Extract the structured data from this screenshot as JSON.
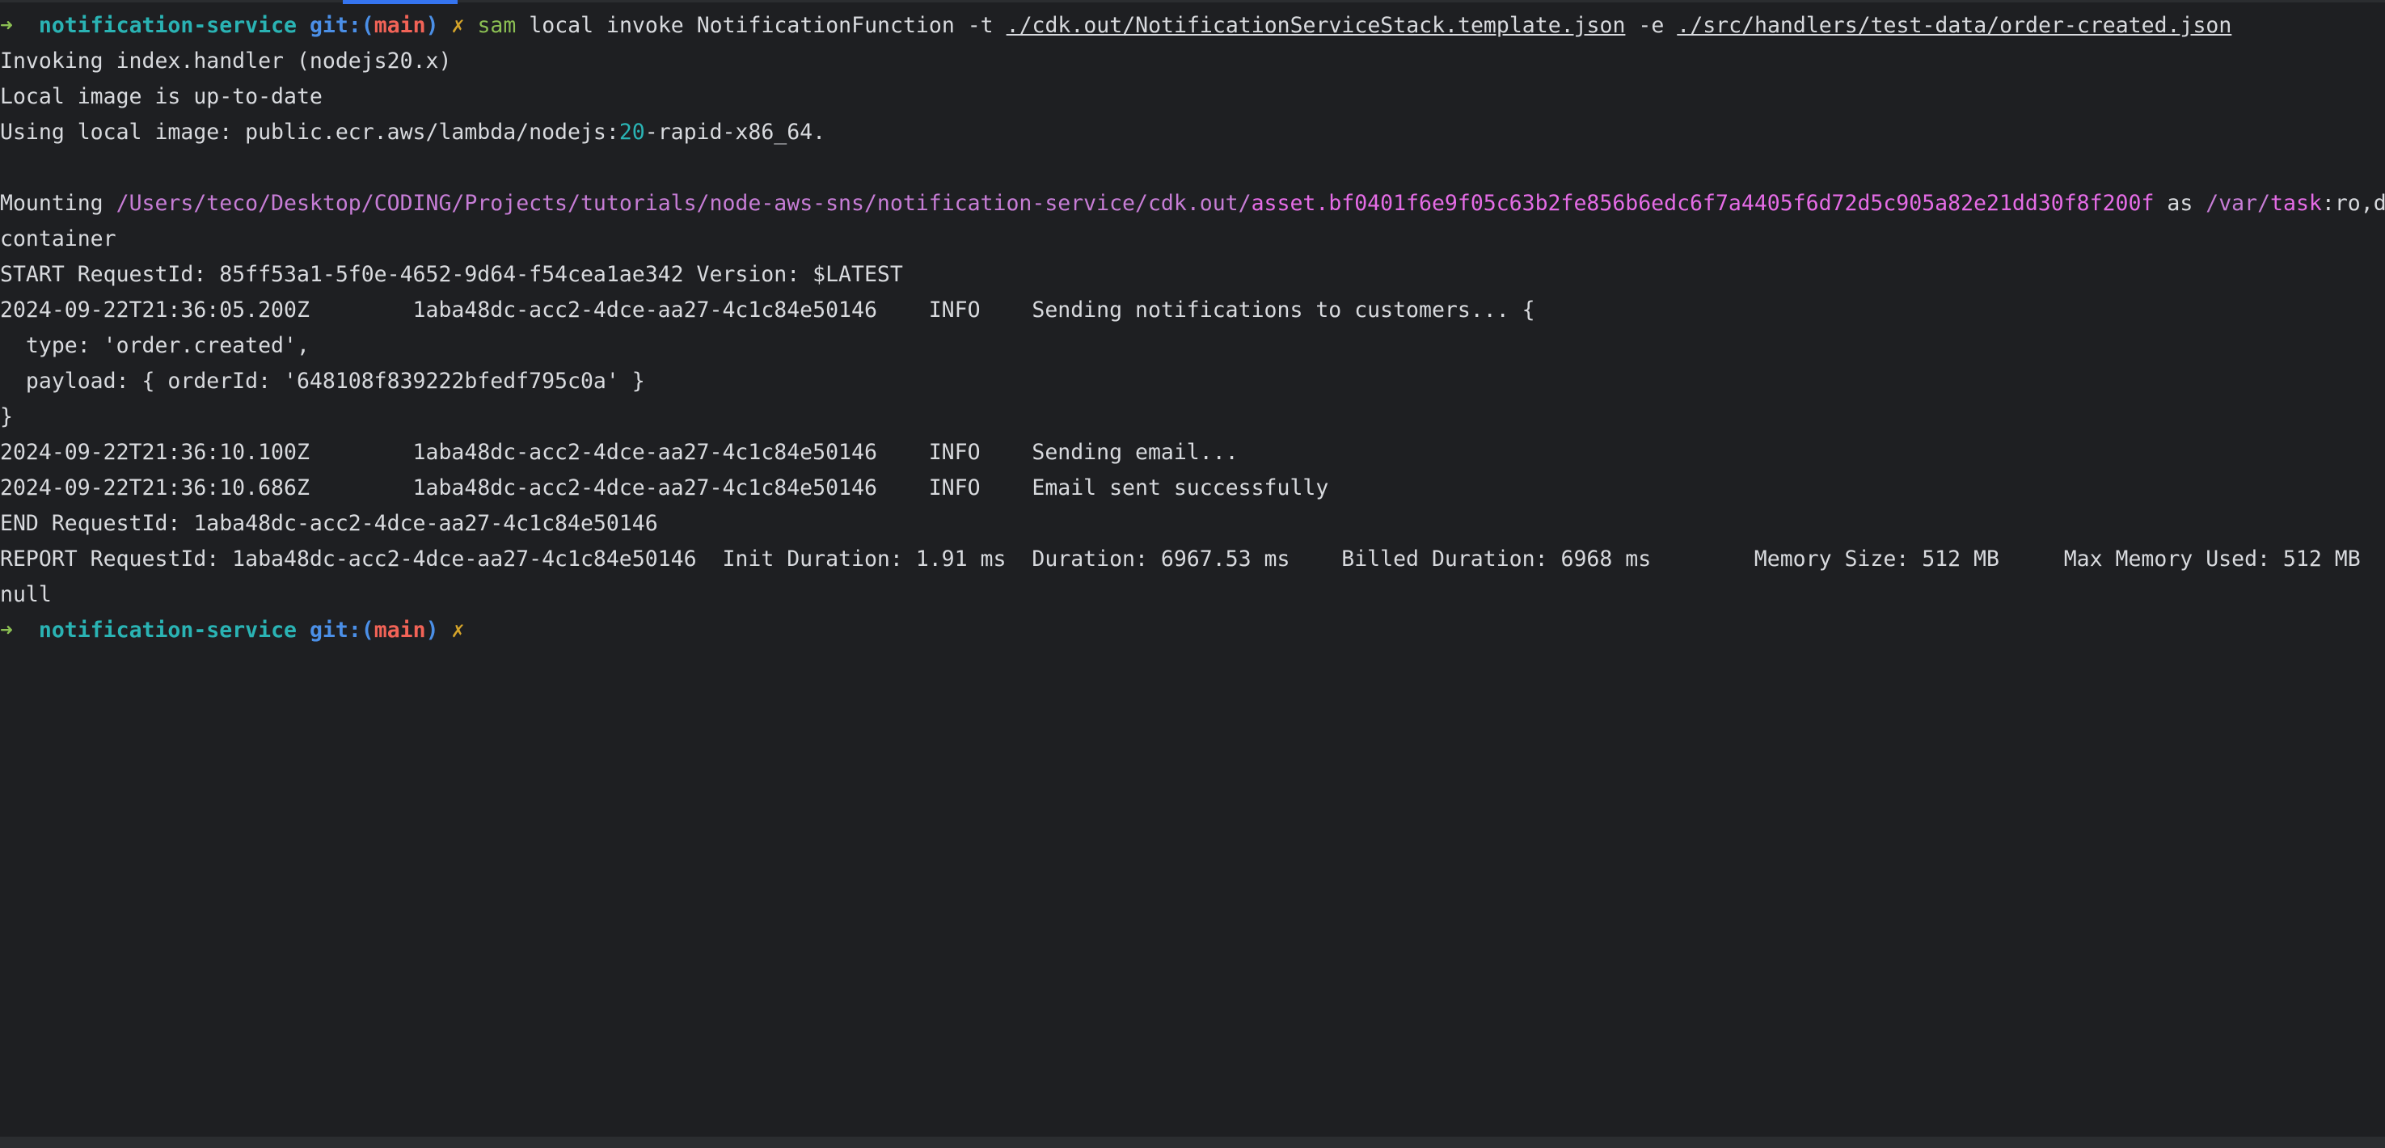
{
  "prompt": {
    "arrow": "➜",
    "directory": "notification-service",
    "git_prefix": "git:(",
    "branch": "main",
    "git_suffix": ")",
    "dirty_marker": "✗"
  },
  "command": {
    "program": "sam",
    "args_part1": "local invoke NotificationFunction -t",
    "template_path": "./cdk.out/NotificationServiceStack.template.json",
    "flag_e": "-e",
    "event_path": "./src/handlers/test-data/order-created.json"
  },
  "output": {
    "invoking": "Invoking index.handler (nodejs20.x)",
    "image_uptodate": "Local image is up-to-date",
    "using_image_prefix": "Using local image: public.ecr.aws/lambda/nodejs:",
    "using_image_version": "20",
    "using_image_suffix": "-rapid-x86_64.",
    "mounting_label": "Mounting",
    "mount_path": "/Users/teco/Desktop/CODING/Projects/tutorials/node-aws-sns/notification-service/cdk.out/",
    "mount_asset": "asset.bf0401f6e9f05c63b2fe856b6edc6f7a4405f6d72d5c905a82e21dd30f8f200f",
    "mount_as": "as",
    "mount_target_prefix": "/var/",
    "mount_target_dir": "task",
    "mount_target_suffix": ":ro,d",
    "container": "container",
    "start": "START RequestId: 85ff53a1-5f0e-4652-9d64-f54cea1ae342 Version: $LATEST",
    "log1": "2024-09-22T21:36:05.200Z\t1aba48dc-acc2-4dce-aa27-4c1c84e50146\tINFO\tSending notifications to customers... {",
    "log1_type": "  type: 'order.created',",
    "log1_payload": "  payload: { orderId: '648108f839222bfedf795c0a' }",
    "log1_close": "}",
    "log2": "2024-09-22T21:36:10.100Z\t1aba48dc-acc2-4dce-aa27-4c1c84e50146\tINFO\tSending email...",
    "log3": "2024-09-22T21:36:10.686Z\t1aba48dc-acc2-4dce-aa27-4c1c84e50146\tINFO\tEmail sent successfully",
    "end": "END RequestId: 1aba48dc-acc2-4dce-aa27-4c1c84e50146",
    "report": "REPORT RequestId: 1aba48dc-acc2-4dce-aa27-4c1c84e50146\tInit Duration: 1.91 ms\tDuration: 6967.53 ms\tBilled Duration: 6968 ms\tMemory Size: 512 MB\tMax Memory Used: 512 MB",
    "result": "null"
  },
  "colors": {
    "background": "#1e1f22",
    "foreground": "#d8dade",
    "prompt_arrow": "#8bbf53",
    "directory": "#2ab3b4",
    "git": "#4b8fe7",
    "branch": "#f26357",
    "dirty_marker": "#d5a42a",
    "path": "#c77dd6",
    "asset": "#e56ce6",
    "tab_indicator": "#3574f0"
  }
}
